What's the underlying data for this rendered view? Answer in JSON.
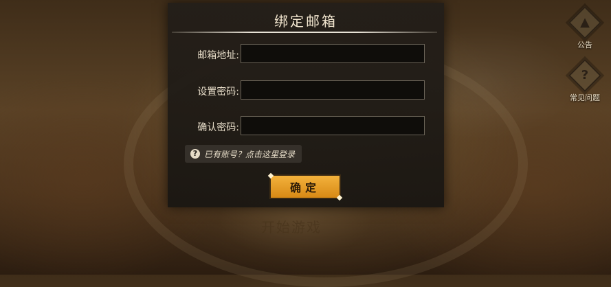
{
  "background": {
    "faint_text": "开始游戏"
  },
  "side_buttons": {
    "notice_label": "公告",
    "faq_label": "常见问题",
    "faq_glyph": "?"
  },
  "dialog": {
    "title": "绑定邮箱",
    "fields": [
      {
        "label": "邮箱地址:",
        "value": "",
        "placeholder": ""
      },
      {
        "label": "设置密码:",
        "value": "",
        "placeholder": ""
      },
      {
        "label": "确认密码:",
        "value": "",
        "placeholder": ""
      }
    ],
    "login_link_text": "已有账号？点击这里登录",
    "help_glyph": "?",
    "confirm_label": "确定"
  },
  "colors": {
    "accent": "#e9a027",
    "panel": "#231e19"
  }
}
